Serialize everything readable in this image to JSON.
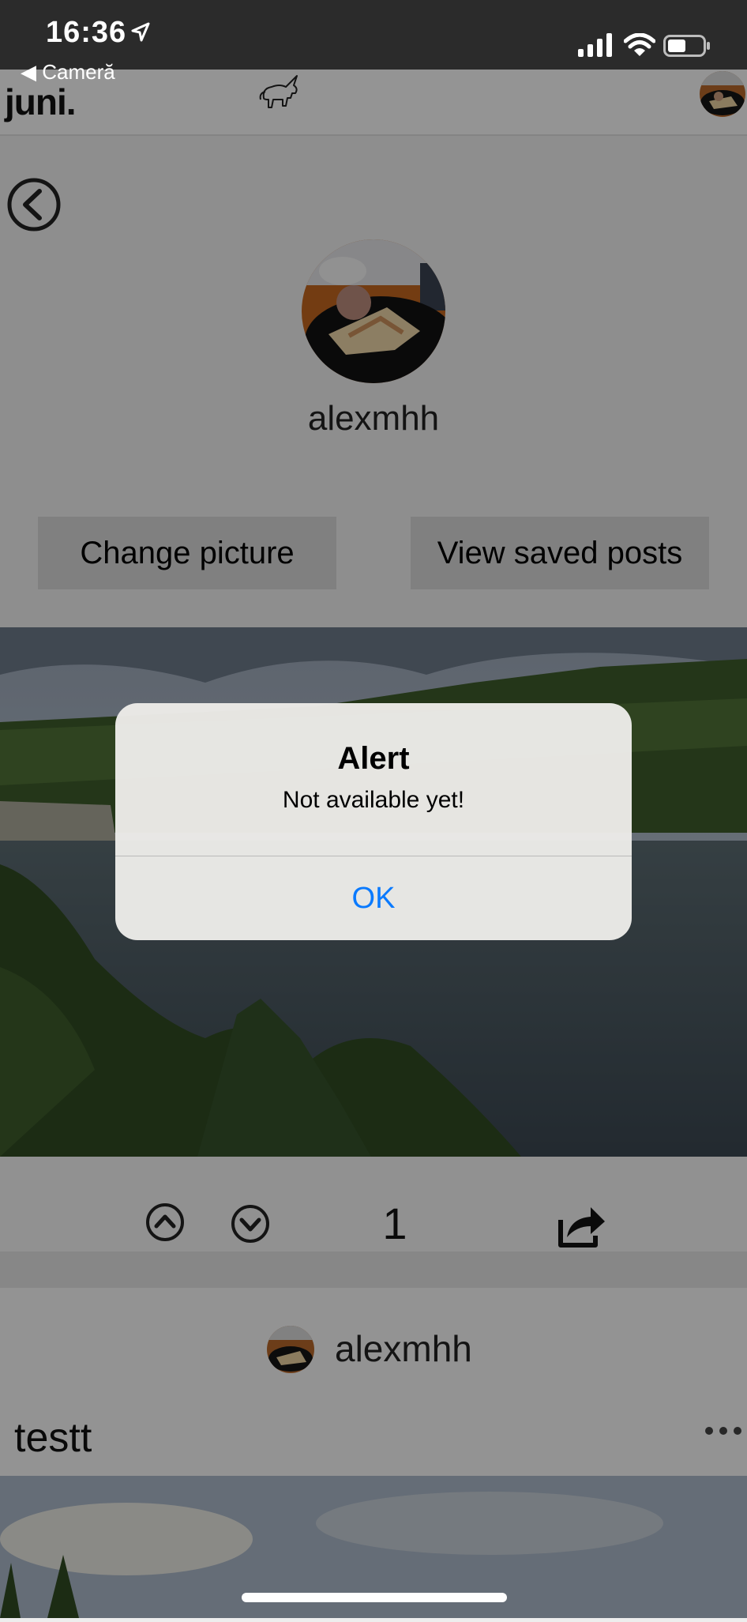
{
  "status_bar": {
    "time": "16:36",
    "back_app_label": "◀ Cameră",
    "icons": [
      "location-arrow-icon",
      "signal-icon",
      "wifi-icon",
      "battery-icon"
    ]
  },
  "header": {
    "logo": "juni.",
    "mascot_icon": "unicorn-icon",
    "avatar_icon": "avatar"
  },
  "profile": {
    "back_icon": "back-circle-icon",
    "username": "alexmhh",
    "change_picture_label": "Change picture",
    "view_saved_label": "View saved posts"
  },
  "post1": {
    "vote_count": "1",
    "icons": [
      "upvote-icon",
      "downvote-icon",
      "share-icon"
    ]
  },
  "post2": {
    "author": "alexmhh",
    "title": "testt",
    "more_icon": "more-dots-icon"
  },
  "alert": {
    "title": "Alert",
    "message": "Not available yet!",
    "ok_label": "OK"
  },
  "colors": {
    "status_bar": "#2b2b2b",
    "alert_action": "#0a7afe",
    "button_bg": "#d6d6d6"
  }
}
